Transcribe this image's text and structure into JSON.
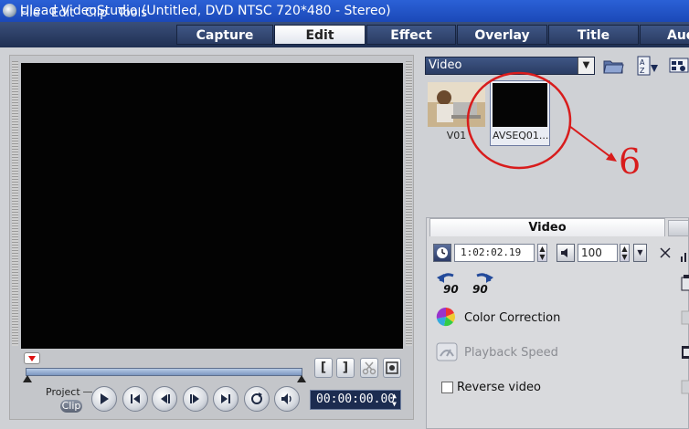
{
  "window": {
    "title": "Ulead VideoStudio (Untitled, DVD NTSC 720*480 - Stereo)"
  },
  "menu": [
    "File",
    "Edit",
    "Clip",
    "Tools"
  ],
  "tabs": [
    {
      "label": "Capture",
      "active": false
    },
    {
      "label": "Edit",
      "active": true
    },
    {
      "label": "Effect",
      "active": false
    },
    {
      "label": "Overlay",
      "active": false
    },
    {
      "label": "Title",
      "active": false
    },
    {
      "label": "Audio",
      "active": false
    }
  ],
  "player": {
    "mode_project": "Project",
    "mode_clip": "Clip",
    "mark_in": "[",
    "mark_out": "]",
    "timecode": "00:00:00.00"
  },
  "library": {
    "category": "Video",
    "clips": [
      {
        "label": "V01"
      },
      {
        "label": "AVSEQ01..."
      }
    ]
  },
  "annotation": {
    "number": "6",
    "color": "#d81c1c"
  },
  "options": {
    "tab_label": "Video",
    "duration": "1:02:02.19",
    "volume": "100",
    "rotate_left_label": "90",
    "rotate_right_label": "90",
    "color_correction": "Color Correction",
    "playback_speed": "Playback Speed",
    "reverse_video": "Reverse video"
  }
}
